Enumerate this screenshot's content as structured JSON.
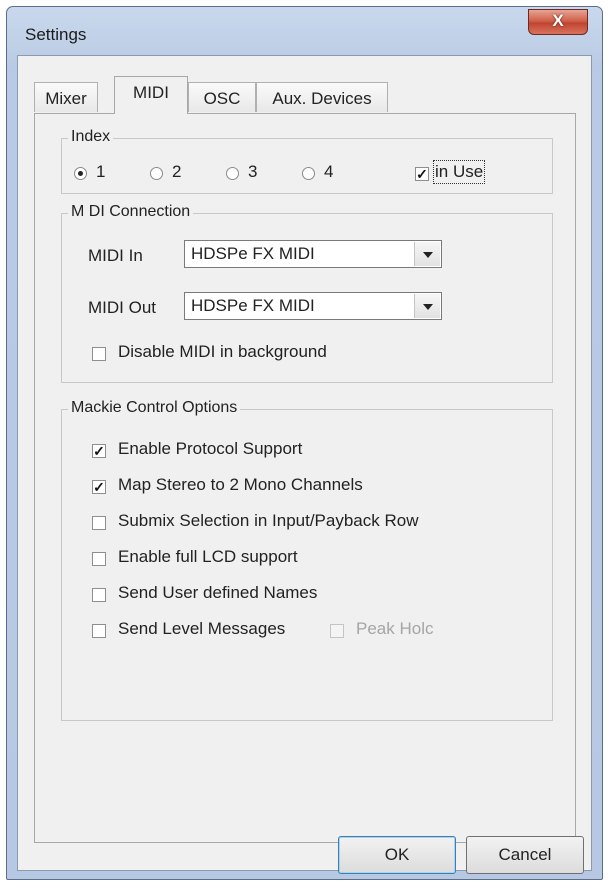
{
  "window": {
    "title": "Settings",
    "close_label": "X"
  },
  "tabs": [
    {
      "label": "Mixer"
    },
    {
      "label": "MIDI"
    },
    {
      "label": "OSC"
    },
    {
      "label": "Aux. Devices"
    }
  ],
  "active_tab": "MIDI",
  "index": {
    "legend": "Index",
    "options": [
      "1",
      "2",
      "3",
      "4"
    ],
    "selected": "1",
    "in_use_label": "in Use",
    "in_use_checked": true
  },
  "midi_connection": {
    "legend": "M DI Connection",
    "midi_in_label": "MIDI In",
    "midi_in_value": "HDSPe FX MIDI",
    "midi_out_label": "MIDI Out",
    "midi_out_value": "HDSPe FX MIDI",
    "disable_bg_label": "Disable MIDI in background",
    "disable_bg_checked": false
  },
  "mackie": {
    "legend": "Mackie Control Options",
    "options": [
      {
        "label": "Enable Protocol Support",
        "checked": true
      },
      {
        "label": "Map Stereo to 2 Mono Channels",
        "checked": true
      },
      {
        "label": "Submix Selection in Input/Payback Row",
        "checked": false
      },
      {
        "label": "Enable full LCD support",
        "checked": false
      },
      {
        "label": "Send User defined Names",
        "checked": false
      },
      {
        "label": "Send Level Messages",
        "checked": false
      }
    ],
    "peak_hold_label": "Peak Holc",
    "peak_hold_checked": false,
    "peak_hold_enabled": false
  },
  "buttons": {
    "ok": "OK",
    "cancel": "Cancel"
  },
  "colors": {
    "close_red": "#c8503a",
    "frame_blue": "#b9cbe4",
    "dialog_bg": "#f0f0f0"
  }
}
